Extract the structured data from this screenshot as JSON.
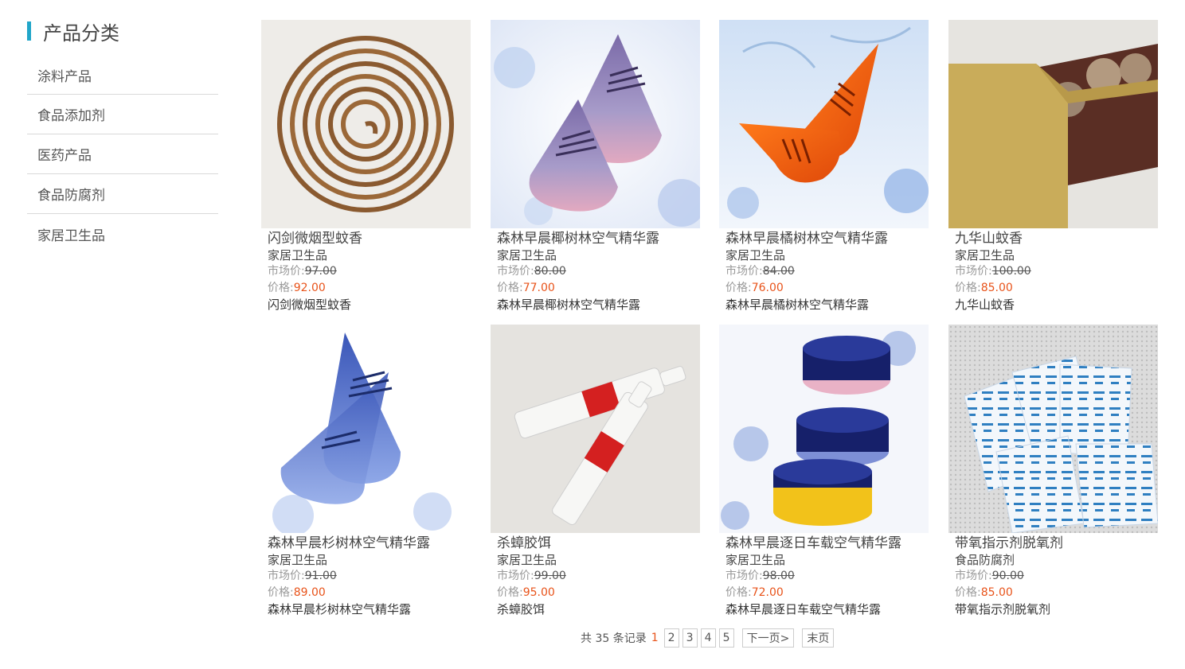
{
  "sidebar": {
    "title": "产品分类",
    "items": [
      {
        "label": "涂料产品"
      },
      {
        "label": "食品添加剂"
      },
      {
        "label": "医药产品"
      },
      {
        "label": "食品防腐剂"
      },
      {
        "label": "家居卫生品"
      }
    ]
  },
  "products": [
    {
      "title": "闪剑微烟型蚊香",
      "category": "家居卫生品",
      "market_label": "市场价:",
      "market_price": "97.00",
      "price_label": "价格:",
      "price": "92.00",
      "desc": "闪剑微烟型蚊香",
      "image": "mosquito-coil-image"
    },
    {
      "title": "森林早晨椰树林空气精华露",
      "category": "家居卫生品",
      "market_label": "市场价:",
      "market_price": "80.00",
      "price_label": "价格:",
      "price": "77.00",
      "desc": "森林早晨椰树林空气精华露",
      "image": "purple-air-freshener-image"
    },
    {
      "title": "森林早晨橘树林空气精华露",
      "category": "家居卫生品",
      "market_label": "市场价:",
      "market_price": "84.00",
      "price_label": "价格:",
      "price": "76.00",
      "desc": "森林早晨橘树林空气精华露",
      "image": "orange-air-freshener-image"
    },
    {
      "title": "九华山蚊香",
      "category": "家居卫生品",
      "market_label": "市场价:",
      "market_price": "100.00",
      "price_label": "价格:",
      "price": "85.00",
      "desc": "九华山蚊香",
      "image": "mosquito-coil-box-image"
    },
    {
      "title": "森林早晨杉树林空气精华露",
      "category": "家居卫生品",
      "market_label": "市场价:",
      "market_price": "91.00",
      "price_label": "价格:",
      "price": "89.00",
      "desc": "森林早晨杉树林空气精华露",
      "image": "blue-air-freshener-image"
    },
    {
      "title": "杀蟑胶饵",
      "category": "家居卫生品",
      "market_label": "市场价:",
      "market_price": "99.00",
      "price_label": "价格:",
      "price": "95.00",
      "desc": "杀蟑胶饵",
      "image": "cockroach-gel-tube-image"
    },
    {
      "title": "森林早晨逐日车载空气精华露",
      "category": "家居卫生品",
      "market_label": "市场价:",
      "market_price": "98.00",
      "price_label": "价格:",
      "price": "72.00",
      "desc": "森林早晨逐日车载空气精华露",
      "image": "car-air-freshener-jars-image"
    },
    {
      "title": "带氧指示剂脱氧剂",
      "category": "食品防腐剂",
      "market_label": "市场价:",
      "market_price": "90.00",
      "price_label": "价格:",
      "price": "85.00",
      "desc": "带氧指示剂脱氧剂",
      "image": "oxygen-absorber-packets-image"
    }
  ],
  "pagination": {
    "total_text": "共 35 条记录",
    "current": "1",
    "pages": [
      "2",
      "3",
      "4",
      "5"
    ],
    "next": "下一页>",
    "last": "末页"
  },
  "colors": {
    "accent": "#21a6c9",
    "price": "#e8531a"
  }
}
